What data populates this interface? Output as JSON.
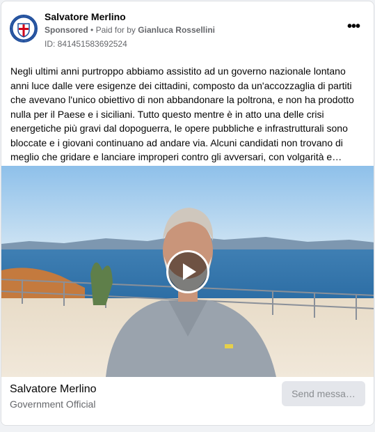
{
  "post": {
    "page_name": "Salvatore Merlino",
    "sponsored_label": "Sponsored",
    "separator": "•",
    "paid_for_prefix": "Paid for by",
    "paid_for_name": "Gianluca Rossellini",
    "ad_id_label": "ID: 841451583692524",
    "more_icon": "more-horizontal-icon",
    "body": "Negli ultimi anni purtroppo abbiamo assistito ad un governo nazionale lontano anni luce dalle vere esigenze dei cittadini, composto da un'accozzaglia di partiti che avevano l'unico obiettivo di non abbandonare la poltrona, e non ha prodotto nulla per il Paese e i siciliani. Tutto questo mentre è in atto una delle crisi energetiche più gravi dal dopoguerra, le opere pubbliche e infrastrutturali sono bloccate e i giovani continuano ad andare via. Alcuni candidati non trovano di meglio che gridare e lanciare improperi contro gli avversari, con volgarità e…"
  },
  "media": {
    "type": "video",
    "play_icon": "play-icon"
  },
  "footer": {
    "name": "Salvatore Merlino",
    "category": "Government Official",
    "cta_label": "Send messa…"
  },
  "colors": {
    "card_bg": "#ffffff",
    "secondary_text": "#65676b",
    "cta_bg": "#e4e6eb",
    "cta_text": "#8a8d91"
  }
}
